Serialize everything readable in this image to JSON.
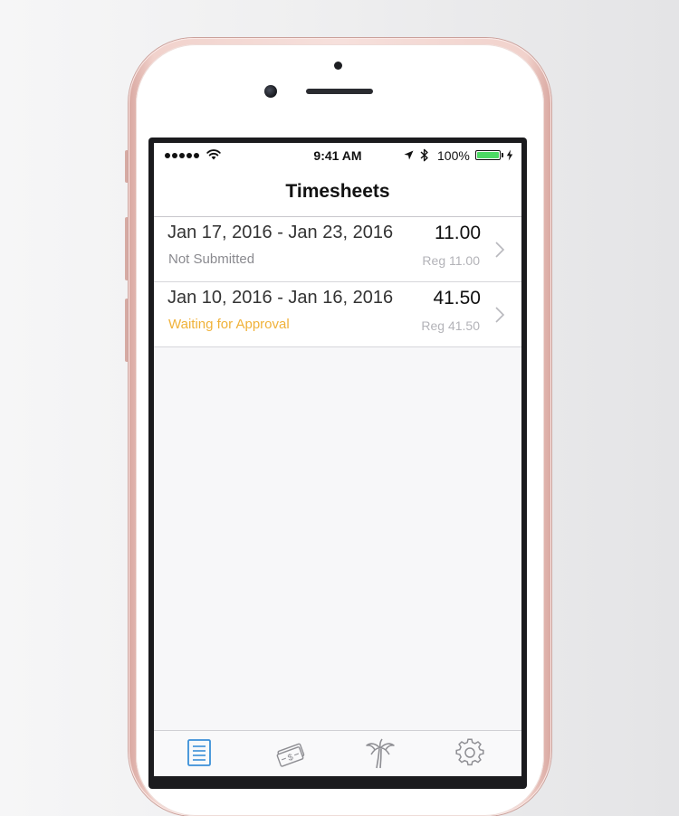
{
  "status_bar": {
    "time": "9:41 AM",
    "battery_percent": "100%",
    "battery_level": 1.0,
    "signal_dots": 5
  },
  "nav": {
    "title": "Timesheets"
  },
  "timesheets": [
    {
      "dates": "Jan 17, 2016 - Jan 23, 2016",
      "status": "Not Submitted",
      "hours": "11.00",
      "regular": "Reg 11.00"
    },
    {
      "dates": "Jan 10, 2016 - Jan 16, 2016",
      "status": "Waiting for Approval",
      "hours": "41.50",
      "regular": "Reg 41.50"
    }
  ],
  "tabs": [
    {
      "icon": "document-list-icon",
      "active": true
    },
    {
      "icon": "money-bills-icon",
      "active": false
    },
    {
      "icon": "palm-tree-icon",
      "active": false
    },
    {
      "icon": "gear-icon",
      "active": false
    }
  ],
  "colors": {
    "accent": "#3a8fd8",
    "waiting": "#f0b23a",
    "battery": "#4cd964",
    "phone_frame": "#f1d2cc"
  }
}
